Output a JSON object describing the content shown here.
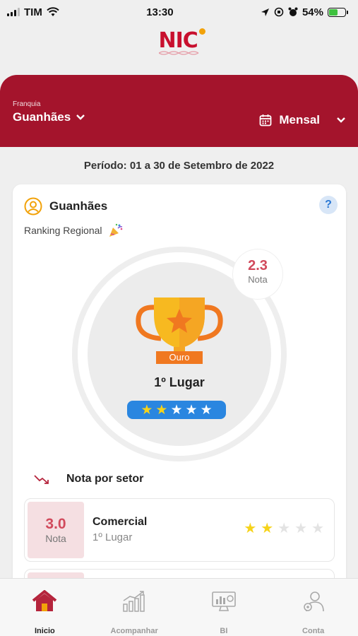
{
  "status_bar": {
    "carrier": "TIM",
    "time": "13:30",
    "battery": "54%"
  },
  "logo": {
    "text": "NIC"
  },
  "header": {
    "franquia_label": "Franquia",
    "franquia_value": "Guanhães",
    "period_value": "Mensal",
    "icons": {
      "franquia_chevron": "chevron-down-icon",
      "calendar": "calendar-icon",
      "period_chevron": "chevron-down-icon"
    }
  },
  "periodo_text": "Período: 01 a 30 de Setembro de 2022",
  "card": {
    "title": "Guanhães",
    "help": "?",
    "ranking_label": "Ranking Regional",
    "nota_value": "2.3",
    "nota_label": "Nota",
    "medal_label": "Ouro",
    "position": "1º Lugar",
    "stars_rating": 2,
    "stars_total": 5
  },
  "setor": {
    "heading": "Nota por setor",
    "items": [
      {
        "score": "3.0",
        "score_label": "Nota",
        "name": "Comercial",
        "position": "1º Lugar",
        "stars_rating": 2,
        "stars_total": 5
      }
    ]
  },
  "nav": [
    {
      "label": "Inicio",
      "icon": "home-icon",
      "active": true
    },
    {
      "label": "Acompanhar",
      "icon": "chart-growth-icon",
      "active": false
    },
    {
      "label": "BI",
      "icon": "dashboard-monitor-icon",
      "active": false
    },
    {
      "label": "Conta",
      "icon": "user-settings-icon",
      "active": false
    }
  ],
  "colors": {
    "brand_red": "#a4142c",
    "accent_pink": "#d14a5c",
    "star_yellow": "#f6d31a",
    "pill_blue": "#2a86e0"
  }
}
